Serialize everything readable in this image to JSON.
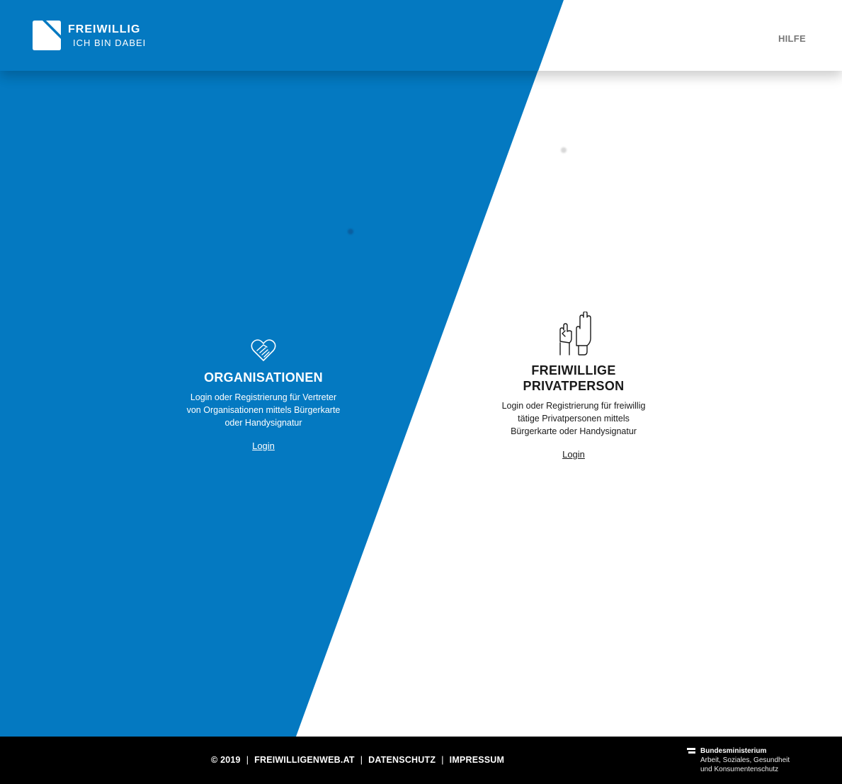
{
  "colors": {
    "brand_blue": "#0479c1",
    "footer_bg": "#000000",
    "white": "#ffffff"
  },
  "header": {
    "logo": {
      "title": "FREIWILLIG",
      "subtitle": "ICH BIN DABEI"
    },
    "nav": {
      "help_label": "HILFE"
    }
  },
  "organisations": {
    "icon": "heart-handshake-icon",
    "title": "ORGANISATIONEN",
    "description": "Login oder Registrierung für Vertreter von Organisationen mittels Bürgerkarte oder Handysignatur",
    "link_label": "Login"
  },
  "private": {
    "icon": "raised-hands-icon",
    "title": "FREIWILLIGE PRIVATPERSON",
    "description": "Login oder Registrierung für freiwillig tätige Privatpersonen mittels Bürgerkarte oder Handysignatur",
    "link_label": "Login"
  },
  "footer": {
    "copyright": "© 2019",
    "site_link": "FREIWILLIGENWEB.AT",
    "privacy_link": "DATENSCHUTZ",
    "imprint_link": "IMPRESSUM",
    "separator": "|",
    "ministry": {
      "line1": "Bundesministerium",
      "line2": "Arbeit, Soziales, Gesundheit",
      "line3": "und Konsumentenschutz"
    }
  }
}
